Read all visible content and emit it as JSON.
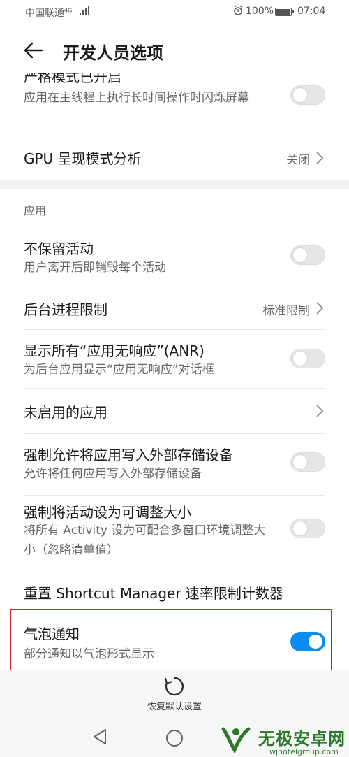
{
  "status_bar": {
    "carrier": "中国联通",
    "network_type": "4G",
    "battery": "100%",
    "time": "07:04"
  },
  "header": {
    "title": "开发人员选项"
  },
  "items": {
    "cut_top": {
      "title": "严格模式已开启",
      "subtitle": "应用在主线程上执行长时间操作时闪烁屏幕",
      "toggle_on": false
    },
    "gpu_render": {
      "title": "GPU 呈现模式分析",
      "value": "关闭"
    },
    "section_apps": "应用",
    "dont_keep_activities": {
      "title": "不保留活动",
      "subtitle": "用户离开后即销毁每个活动",
      "toggle_on": false
    },
    "background_limit": {
      "title": "后台进程限制",
      "value": "标准限制"
    },
    "show_anr": {
      "title": "显示所有“应用无响应”(ANR)",
      "subtitle": "为后台应用显示“应用无响应”对话框",
      "toggle_on": false
    },
    "inactive_apps": {
      "title": "未启用的应用"
    },
    "force_external": {
      "title": "强制允许将应用写入外部存储设备",
      "subtitle": "允许将任何应用写入外部存储设备",
      "toggle_on": false
    },
    "force_resizable": {
      "title": "强制将活动设为可调整大小",
      "subtitle": "将所有 Activity 设为可配合多窗口环境调整大小（忽略清单值）",
      "toggle_on": false
    },
    "reset_shortcut": {
      "title": "重置 Shortcut Manager 速率限制计数器"
    },
    "bubbles": {
      "title": "气泡通知",
      "subtitle": "部分通知以气泡形式显示",
      "toggle_on": true
    }
  },
  "reset_defaults": {
    "label": "恢复默认设置"
  },
  "watermark": {
    "name": "无极安卓网",
    "url": "wjhotelgroup.com"
  },
  "colors": {
    "accent": "#0a8cf0",
    "highlight_border": "#d2242a",
    "watermark_green": "#2a7a2a"
  }
}
